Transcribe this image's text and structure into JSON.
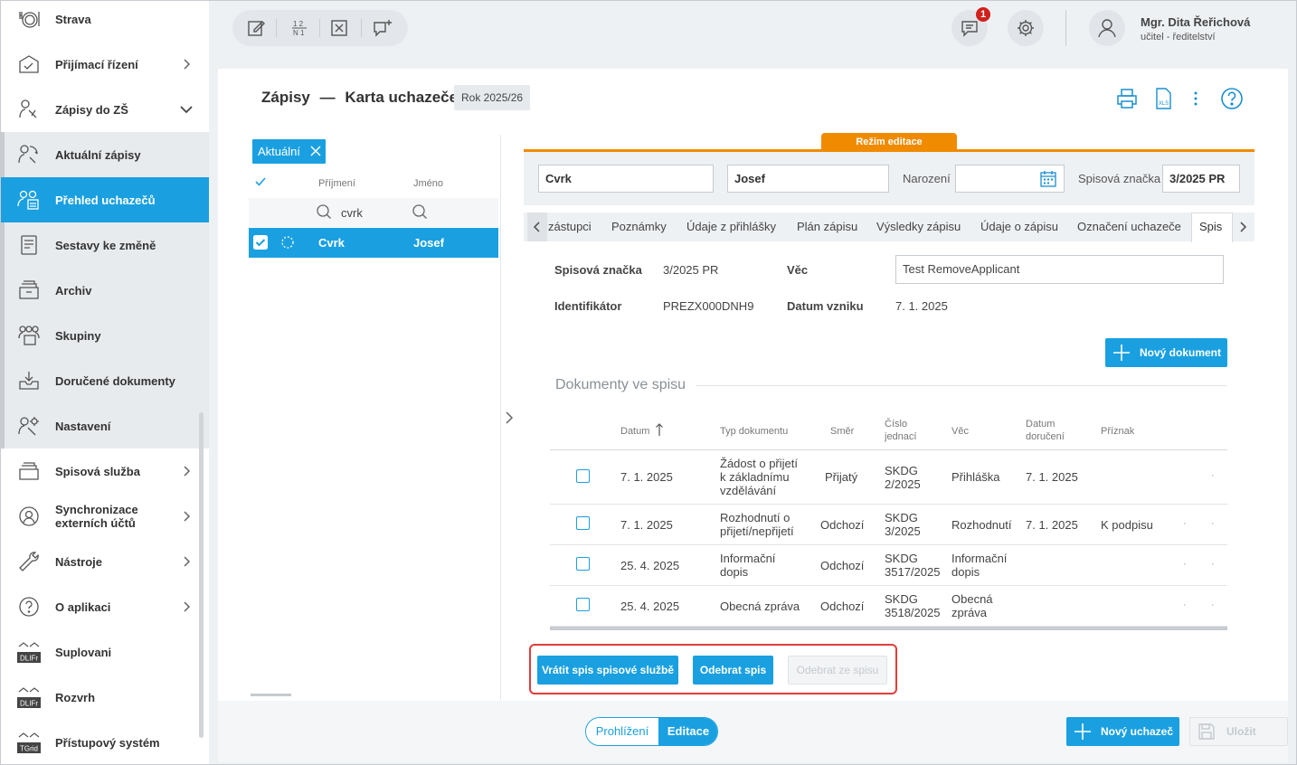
{
  "sidebar": {
    "items": [
      {
        "label": "Strava",
        "icon": "meal-icon"
      },
      {
        "label": "Přijímací řízení",
        "icon": "admission-icon"
      },
      {
        "label": "Zápisy do ZŠ",
        "icon": "enrollment-icon"
      },
      {
        "label": "Aktuální zápisy",
        "icon": "current-enrollment-icon"
      },
      {
        "label": "Přehled uchazečů",
        "icon": "applicants-icon"
      },
      {
        "label": "Sestavy ke změně",
        "icon": "reports-icon"
      },
      {
        "label": "Archiv",
        "icon": "archive-icon"
      },
      {
        "label": "Skupiny",
        "icon": "groups-icon"
      },
      {
        "label": "Doručené dokumenty",
        "icon": "inbox-icon"
      },
      {
        "label": "Nastavení",
        "icon": "settings-icon"
      },
      {
        "label": "Spisová služba",
        "icon": "file-service-icon"
      },
      {
        "label": "Synchronizace externích účtů",
        "icon": "sync-icon"
      },
      {
        "label": "Nástroje",
        "icon": "wrench-icon"
      },
      {
        "label": "O aplikaci",
        "icon": "help-icon"
      },
      {
        "label": "Suplovani",
        "icon": "dlife-icon",
        "badge": "DLIFr"
      },
      {
        "label": "Rozvrh",
        "icon": "dlife-icon",
        "badge": "DLIFr"
      },
      {
        "label": "Přístupový systém",
        "icon": "tgrid-icon",
        "badge": "TGrid"
      }
    ]
  },
  "topbar": {
    "notifications": "1",
    "user_name": "Mgr. Dita Řeřichová",
    "user_role": "učitel - ředitelství"
  },
  "header": {
    "title_section": "Zápisy",
    "title_dash": "—",
    "title_page": "Karta uchazeče",
    "year": "Rok 2025/26"
  },
  "list": {
    "filter_chip": "Aktuální",
    "col_surname": "Příjmení",
    "col_name": "Jméno",
    "filter_value": "cvrk",
    "row": {
      "surname": "Cvrk",
      "name": "Josef"
    }
  },
  "form": {
    "mode_tab": "Režim editace",
    "surname": "Cvrk",
    "name": "Josef",
    "birth_label": "Narození",
    "birth_value": "",
    "file_label": "Spisová značka",
    "file_value": "3/2025 PR"
  },
  "tabs": [
    "zástupci",
    "Poznámky",
    "Údaje z přihlášky",
    "Plán zápisu",
    "Výsledky zápisu",
    "Údaje o zápisu",
    "Označení uchazeče",
    "Spis"
  ],
  "detail": {
    "file_label": "Spisová značka",
    "file_value": "3/2025 PR",
    "subject_label": "Věc",
    "subject_value": "Test RemoveApplicant",
    "id_label": "Identifikátor",
    "id_value": "PREZX000DNH9",
    "created_label": "Datum vzniku",
    "created_value": "7. 1. 2025",
    "new_doc_button": "Nový dokument",
    "docs_title": "Dokumenty ve spisu"
  },
  "table": {
    "headers": {
      "date": "Datum",
      "type": "Typ dokumentu",
      "direction": "Směr",
      "ref_1": "Číslo",
      "ref_2": "jednací",
      "subject": "Věc",
      "delivered_1": "Datum",
      "delivered_2": "doručení",
      "flag": "Příznak"
    },
    "rows": [
      {
        "date": "7. 1. 2025",
        "type": [
          "Žádost o přijetí",
          "k základnímu",
          "vzdělávání"
        ],
        "direction": "Přijatý",
        "ref": [
          "SKDG",
          "2/2025"
        ],
        "subject": [
          "Přihláška"
        ],
        "delivered": "7. 1. 2025",
        "flag": ""
      },
      {
        "date": "7. 1. 2025",
        "type": [
          "Rozhodnutí o",
          "přijetí/nepřijetí"
        ],
        "direction": "Odchozí",
        "ref": [
          "SKDG",
          "3/2025"
        ],
        "subject": [
          "Rozhodnutí"
        ],
        "delivered": "7. 1. 2025",
        "flag": "K podpisu"
      },
      {
        "date": "25. 4. 2025",
        "type": [
          "Informační",
          "dopis"
        ],
        "direction": "Odchozí",
        "ref": [
          "SKDG",
          "3517/2025"
        ],
        "subject": [
          "Informační",
          "dopis"
        ],
        "delivered": "",
        "flag": ""
      },
      {
        "date": "25. 4. 2025",
        "type": [
          "Obecná zpráva"
        ],
        "direction": "Odchozí",
        "ref": [
          "SKDG",
          "3518/2025"
        ],
        "subject": [
          "Obecná",
          "zpráva"
        ],
        "delivered": "",
        "flag": ""
      }
    ]
  },
  "actions": {
    "return_file": "Vrátit spis spisové službě",
    "remove_file": "Odebrat spis",
    "remove_from_file": "Odebrat ze spisu"
  },
  "footer": {
    "view_mode": "Prohlížení",
    "edit_mode": "Editace",
    "new_applicant": "Nový uchazeč",
    "save": "Uložit"
  },
  "colors": {
    "accent": "#1aa0e0",
    "edit_mode": "#f08b00",
    "highlight_box": "#e23c3c"
  }
}
